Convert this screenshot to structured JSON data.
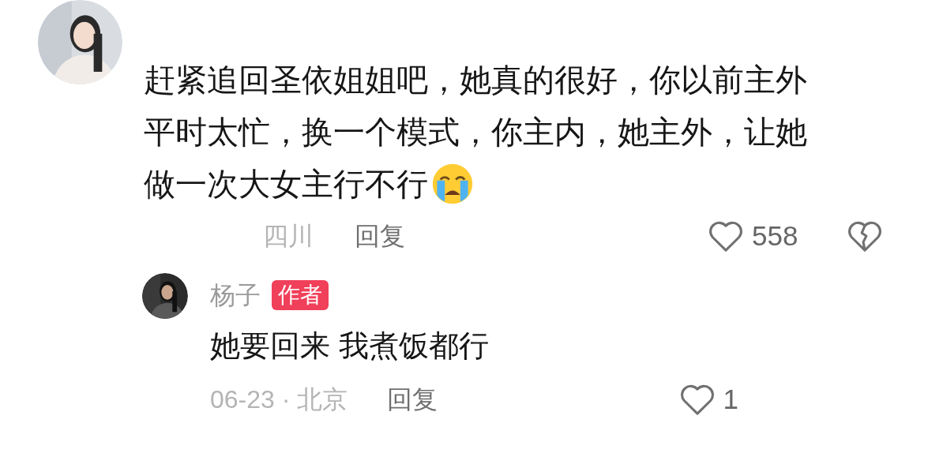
{
  "comment": {
    "text_lines": [
      "赶紧追回圣依姐姐吧，她真的很好，你以前主外",
      "平时太忙，换一个模式，你主内，她主外，让她",
      "做一次大女主行不行"
    ],
    "location": "四川",
    "reply_label": "回复",
    "likes": "558",
    "replies": [
      {
        "author": "杨子",
        "badge": "作者",
        "text": "她要回来 我煮饭都行",
        "meta": "06-23 · 北京",
        "reply_label": "回复",
        "likes": "1"
      }
    ]
  }
}
